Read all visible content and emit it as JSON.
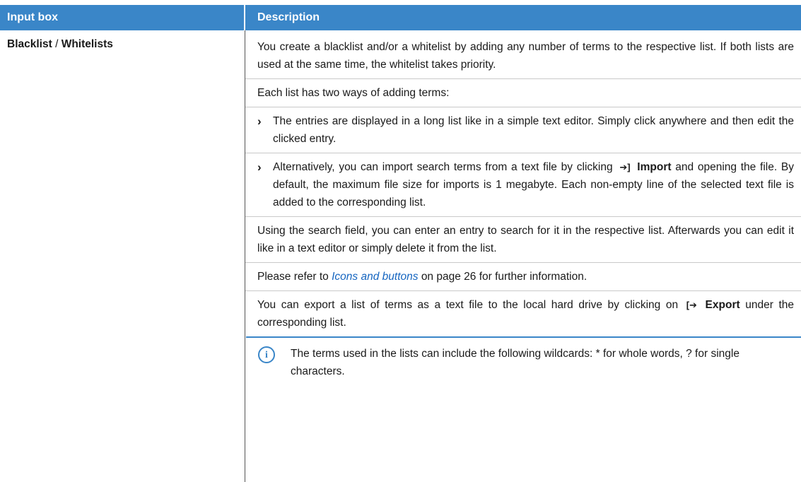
{
  "header": {
    "col1": "Input box",
    "col2": "Description"
  },
  "row": {
    "label_a": "Blacklist",
    "label_sep": " / ",
    "label_b": "Whitelists",
    "p1": "You create a blacklist and/or a whitelist by adding any number of terms to the respective list. If both lists are used at the same time, the whitelist takes priority.",
    "p2": "Each list has two ways of adding terms:",
    "bullet_mark": "›",
    "b1": "The entries are displayed in a long list like in a simple text editor. Simply click anywhere and then edit the clicked entry.",
    "b2_pre": "Alternatively, you can import search terms from a text file by clicking",
    "b2_import_icon": "➔]",
    "b2_import": "Import",
    "b2_post": "and opening the file. By default, the maximum file size for imports is 1 megabyte. Each non-empty line of the selected text file is added to the corresponding list.",
    "p3": "Using the search field, you can enter an entry to search for it in the respective list. Afterwards you can edit it like in a text editor or simply delete it from the list.",
    "p4_pre": "Please refer to",
    "p4_link": "Icons and buttons",
    "p4_post": "on page 26 for further information.",
    "p5_pre": "You can export a list of terms as a text file to the local hard drive by clicking on",
    "p5_export_icon": "[➔",
    "p5_export": "Export",
    "p5_post": "under the corresponding list.",
    "note_icon": "i",
    "note": "The terms used in the lists can include the following wildcards: * for whole words, ? for single characters."
  }
}
